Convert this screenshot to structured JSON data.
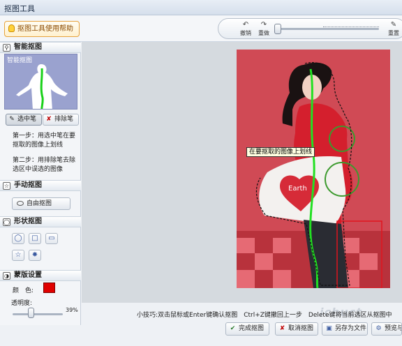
{
  "window": {
    "title": "抠图工具"
  },
  "toolbar": {
    "help_label": "抠图工具使用帮助",
    "undo_label": "撤销",
    "redo_label": "重做",
    "reset_label": "重置"
  },
  "sidebar": {
    "smart": {
      "title": "智能抠图",
      "preview_caption": "智能抠图",
      "select_pen": "选中笔",
      "exclude_pen": "排除笔",
      "step1": "第一步：用选中笔在要抠取的图像上划线",
      "step2": "第二步：用排除笔去除选区中误选的图像"
    },
    "manual": {
      "title": "手动抠图",
      "free_label": "自由抠图"
    },
    "shape": {
      "title": "形状抠图",
      "buttons": [
        "ellipse-icon",
        "rect-icon",
        "rounded-rect-icon",
        "star-icon",
        "burst-icon"
      ]
    },
    "mask": {
      "title": "蒙版设置",
      "color_label": "颜　色:",
      "color_value": "#e00000",
      "opacity_label": "透明度:",
      "opacity_value": "39%"
    }
  },
  "canvas": {
    "tooltip": "在要抠取的图像上划线"
  },
  "footer": {
    "tip": "小技巧:双击鼠标或Enter键确认抠图　Ctrl+Z键撤回上一步　Delete键将当前选区从抠图中",
    "done_label": "完成抠图",
    "cancel_label": "取消抠图",
    "save_label": "另存为文件",
    "preview_label": "预览与"
  }
}
